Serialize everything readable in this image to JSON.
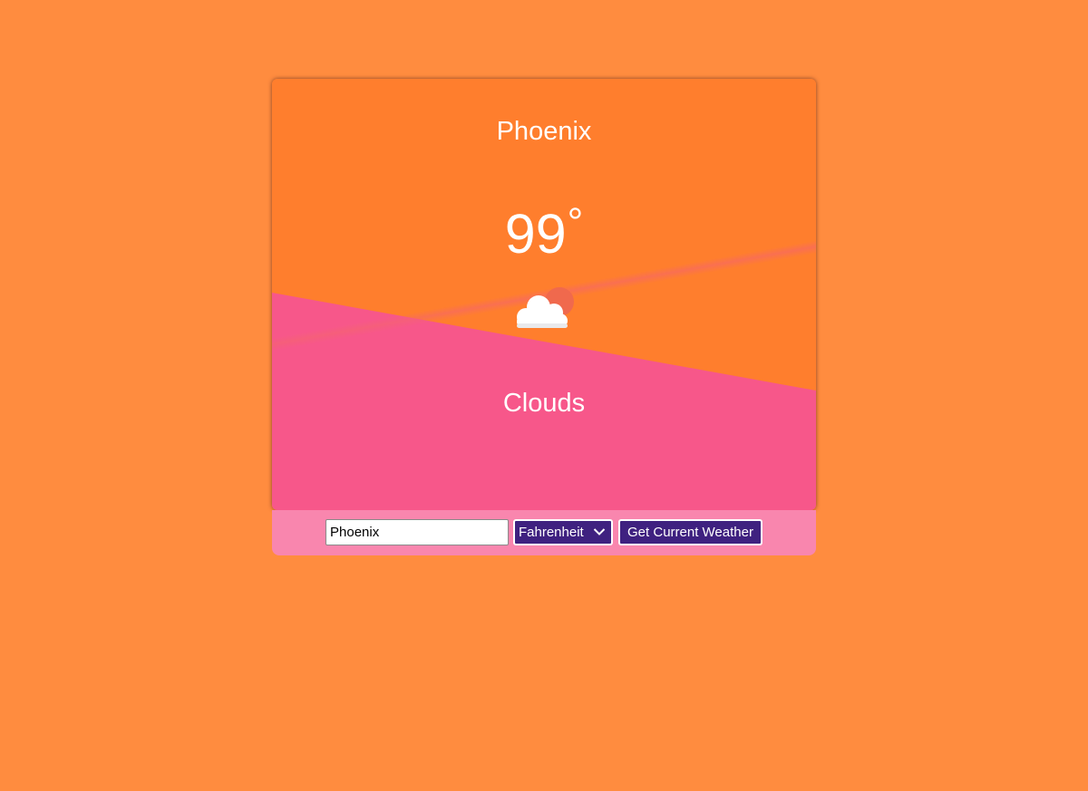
{
  "weather": {
    "city": "Phoenix",
    "temperature": "99",
    "degree_symbol": "°",
    "condition": "Clouds",
    "icon": "partly-cloudy-icon"
  },
  "controls": {
    "city_input_value": "Phoenix",
    "unit_selected": "Fahrenheit",
    "submit_label": "Get Current Weather"
  },
  "colors": {
    "page_background": "#ff8c3f",
    "card_top": "#ff7e2d",
    "card_bottom": "#f7578a",
    "controls_background": "#f986ae",
    "button_background": "#3f2180",
    "sun": "#f0694d"
  }
}
